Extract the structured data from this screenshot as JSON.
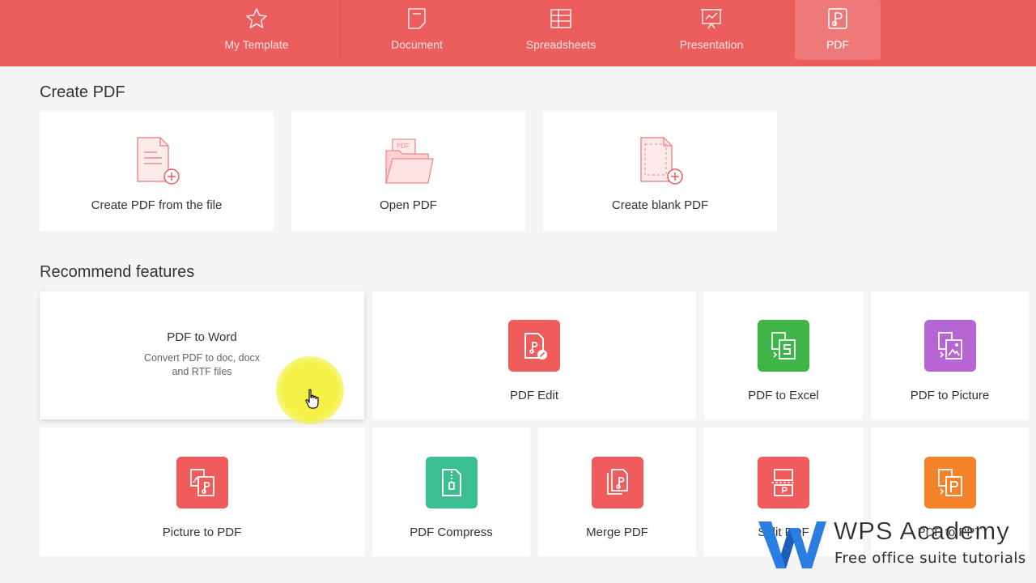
{
  "tabs": [
    {
      "label": "My Template",
      "icon": "star-icon"
    },
    {
      "label": "Document",
      "icon": "document-icon"
    },
    {
      "label": "Spreadsheets",
      "icon": "spreadsheet-icon"
    },
    {
      "label": "Presentation",
      "icon": "presentation-icon"
    },
    {
      "label": "PDF",
      "icon": "pdf-icon",
      "active": true
    }
  ],
  "create": {
    "title": "Create PDF",
    "cards": [
      {
        "label": "Create PDF from the file",
        "icon": "file-add-icon"
      },
      {
        "label": "Open PDF",
        "icon": "folder-pdf-icon"
      },
      {
        "label": "Create blank PDF",
        "icon": "blank-page-add-icon"
      }
    ]
  },
  "recommend": {
    "title": "Recommend features",
    "featured": {
      "title": "PDF to Word",
      "desc_line1": "Convert PDF to doc, docx",
      "desc_line2": "and RTF files"
    },
    "cards": [
      {
        "label": "PDF Edit",
        "icon": "pdf-edit-icon",
        "color": "#f05b5b"
      },
      {
        "label": "PDF to Excel",
        "icon": "pdf-to-excel-icon",
        "color": "#3fb449"
      },
      {
        "label": "PDF to Picture",
        "icon": "pdf-to-picture-icon",
        "color": "#b566d3"
      },
      {
        "label": "Picture to PDF",
        "icon": "picture-to-pdf-icon",
        "color": "#f05b5b"
      },
      {
        "label": "PDF Compress",
        "icon": "pdf-compress-icon",
        "color": "#3cbf90"
      },
      {
        "label": "Merge PDF",
        "icon": "merge-pdf-icon",
        "color": "#f05b5b"
      },
      {
        "label": "Split PDF",
        "icon": "split-pdf-icon",
        "color": "#f05b5b"
      },
      {
        "label": "PDF to PPT",
        "icon": "pdf-to-ppt-icon",
        "color": "#f5822a"
      }
    ]
  },
  "watermark": {
    "title": "WPS Academy",
    "subtitle": "Free office suite tutorials"
  },
  "colors": {
    "topbar": "#ec5e5e",
    "accent": "#f05b5b",
    "background": "#f5f5f5"
  }
}
